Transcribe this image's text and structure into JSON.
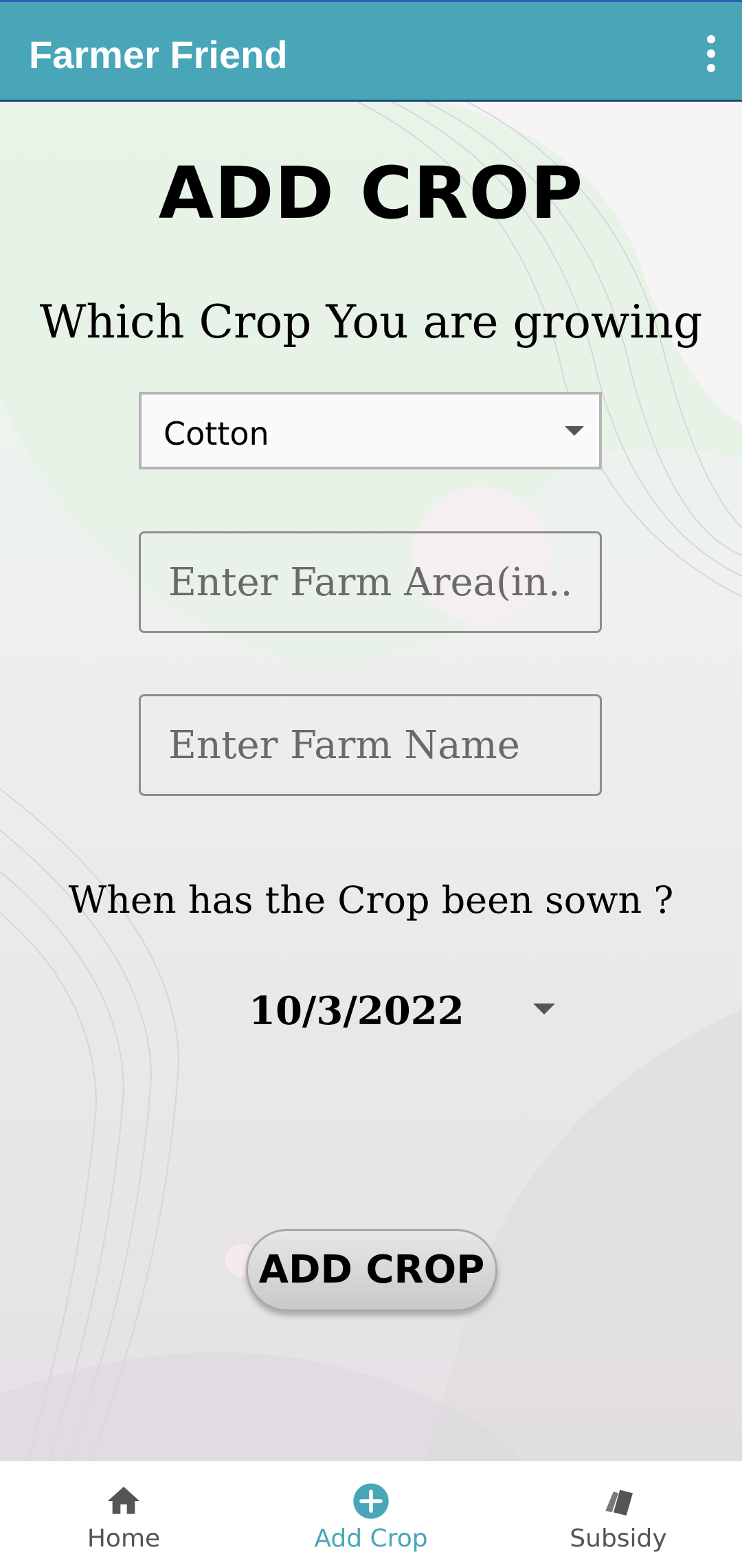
{
  "app": {
    "title": "Farmer Friend",
    "menu_icon": "more-vert-icon"
  },
  "form": {
    "heading": "ADD CROP",
    "crop_question": "Which Crop You are growing",
    "crop_select_value": "Cotton",
    "area_placeholder": "Enter Farm Area(in...",
    "name_placeholder": "Enter Farm Name",
    "sown_question": "When has the Crop been sown ?",
    "sown_date": "10/3/2022",
    "submit_label": "ADD CROP"
  },
  "bottom_nav": {
    "items": [
      {
        "label": "Home",
        "icon": "home-icon",
        "active": false
      },
      {
        "label": "Add Crop",
        "icon": "add-circle-icon",
        "active": true
      },
      {
        "label": "Subsidy",
        "icon": "cards-icon",
        "active": false
      }
    ]
  },
  "colors": {
    "accent": "#49a6b8",
    "appbar": "#49a6b8"
  }
}
